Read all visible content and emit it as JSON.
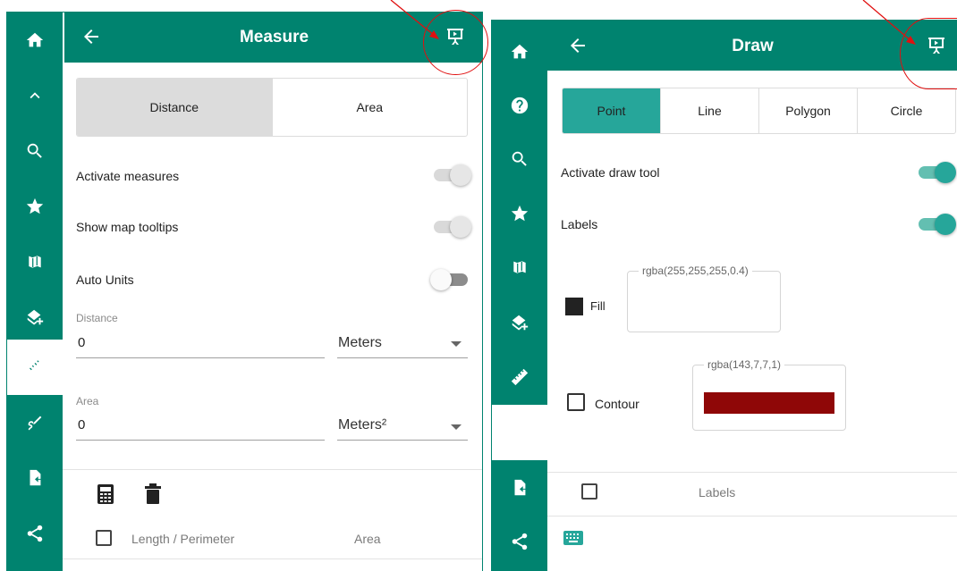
{
  "left_panel": {
    "sidebar": [
      "home-icon",
      "chevron-up-icon",
      "search-icon",
      "star-icon",
      "map-icon",
      "layers-add-icon",
      "ruler-icon",
      "draw-icon",
      "export-file-icon",
      "share-icon"
    ],
    "header": {
      "title": "Measure"
    },
    "tabs": {
      "distance": "Distance",
      "area": "Area"
    },
    "settings": {
      "activate_measures": "Activate measures",
      "show_map_tooltips": "Show map tooltips",
      "auto_units": "Auto Units"
    },
    "distance": {
      "label": "Distance",
      "value": "0",
      "unit": "Meters"
    },
    "area": {
      "label": "Area",
      "value": "0",
      "unit": "Meters²"
    },
    "table": {
      "col_length": "Length / Perimeter",
      "col_area": "Area"
    }
  },
  "right_panel": {
    "sidebar": [
      "home-icon",
      "help-icon",
      "search-icon",
      "star-icon",
      "map-icon",
      "layers-add-icon",
      "ruler-icon",
      "draw-icon",
      "export-file-icon",
      "share-icon"
    ],
    "header": {
      "title": "Draw"
    },
    "tabs": {
      "point": "Point",
      "line": "Line",
      "polygon": "Polygon",
      "circle": "Circle"
    },
    "settings": {
      "activate_draw_tool": "Activate draw tool",
      "labels": "Labels"
    },
    "fill": {
      "label": "Fill",
      "color_value": "rgba(255,255,255,0.4)"
    },
    "contour": {
      "label": "Contour",
      "color_value": "rgba(143,7,7,1)",
      "swatch": "#8f0707"
    },
    "table": {
      "col_labels": "Labels"
    }
  },
  "colors": {
    "primary": "#00836f",
    "accent": "#26a69a",
    "annotation": "#e01010"
  }
}
